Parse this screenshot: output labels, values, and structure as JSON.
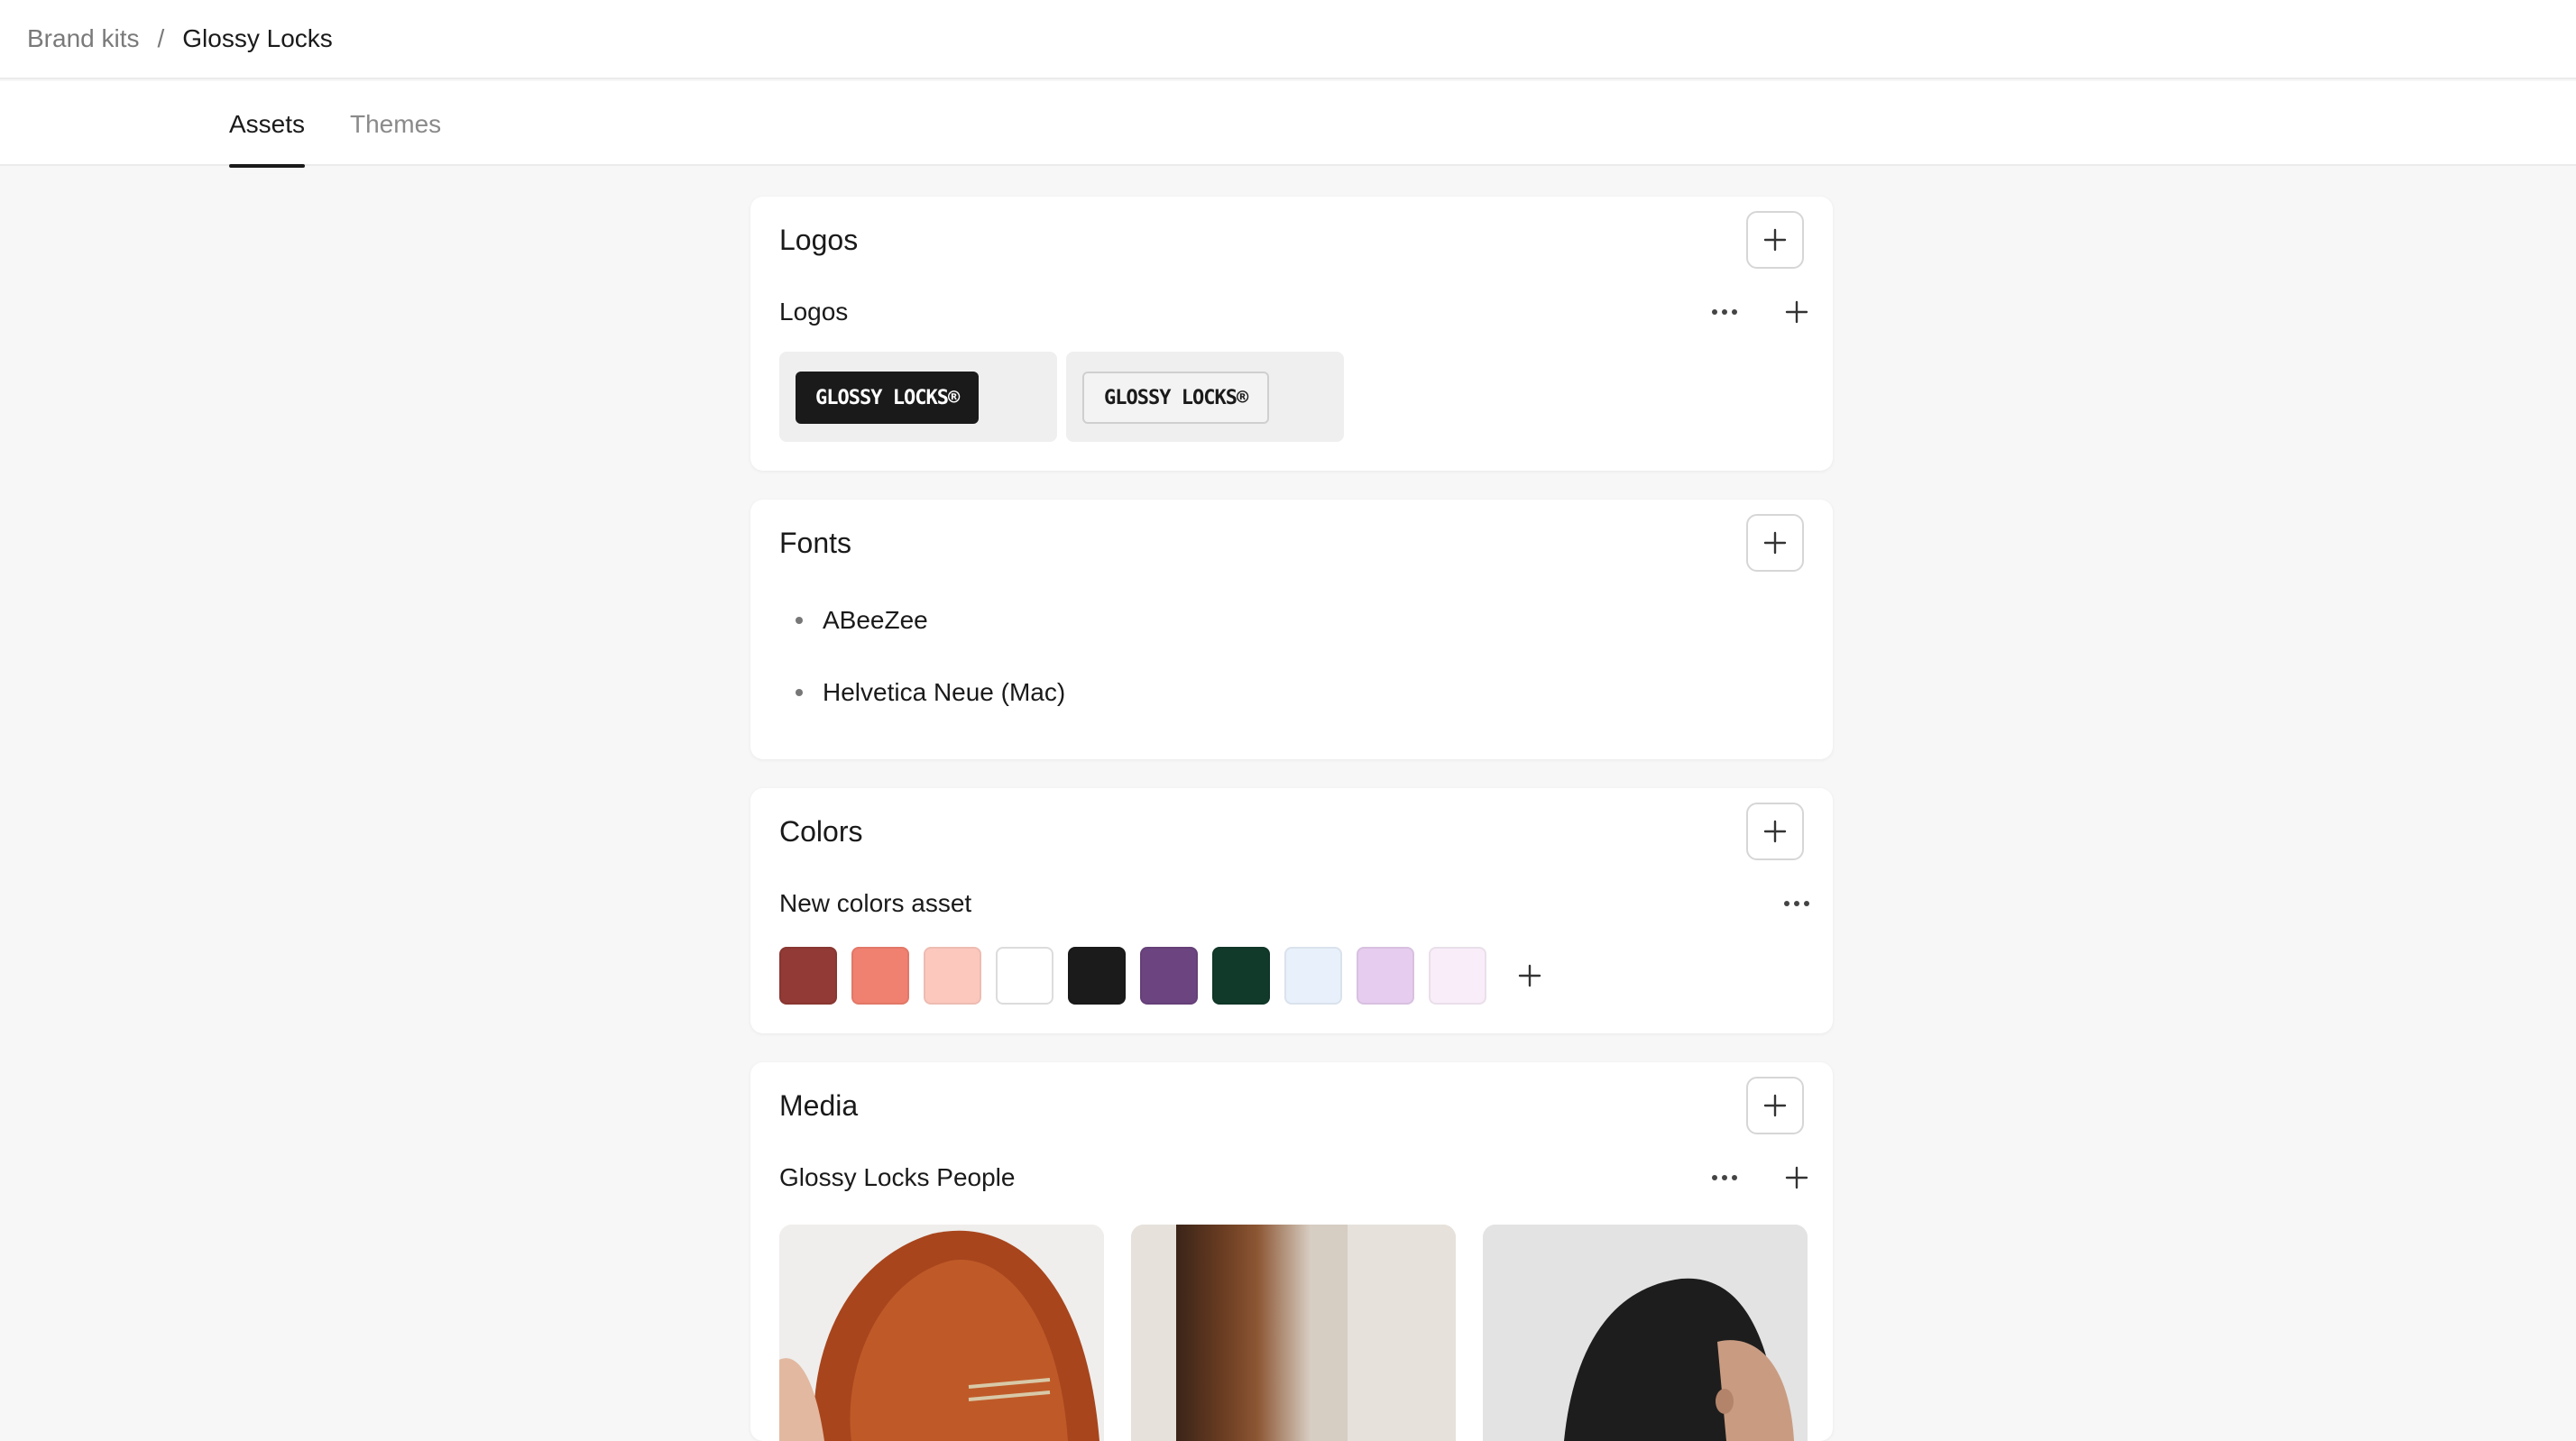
{
  "breadcrumb": {
    "parent": "Brand kits",
    "separator": "/",
    "current": "Glossy Locks"
  },
  "tabs": [
    {
      "label": "Assets",
      "active": true
    },
    {
      "label": "Themes",
      "active": false
    }
  ],
  "logos": {
    "title": "Logos",
    "group_name": "Logos",
    "items": [
      {
        "text": "GLOSSY LOCKS®",
        "variant": "dark"
      },
      {
        "text": "GLOSSY LOCKS®",
        "variant": "light"
      }
    ]
  },
  "fonts": {
    "title": "Fonts",
    "items": [
      "ABeeZee",
      "Helvetica Neue (Mac)"
    ]
  },
  "colors": {
    "title": "Colors",
    "group_name": "New colors asset",
    "swatches": [
      "#923a35",
      "#f08070",
      "#fcc8be",
      "#ffffff",
      "#1b1b1b",
      "#6c4580",
      "#113a2b",
      "#e8f1fb",
      "#e6cdef",
      "#f8edf9"
    ]
  },
  "media": {
    "title": "Media",
    "group_name": "Glossy Locks People"
  },
  "icons": {
    "add": "plus-icon",
    "more": "more-horizontal-icon"
  }
}
